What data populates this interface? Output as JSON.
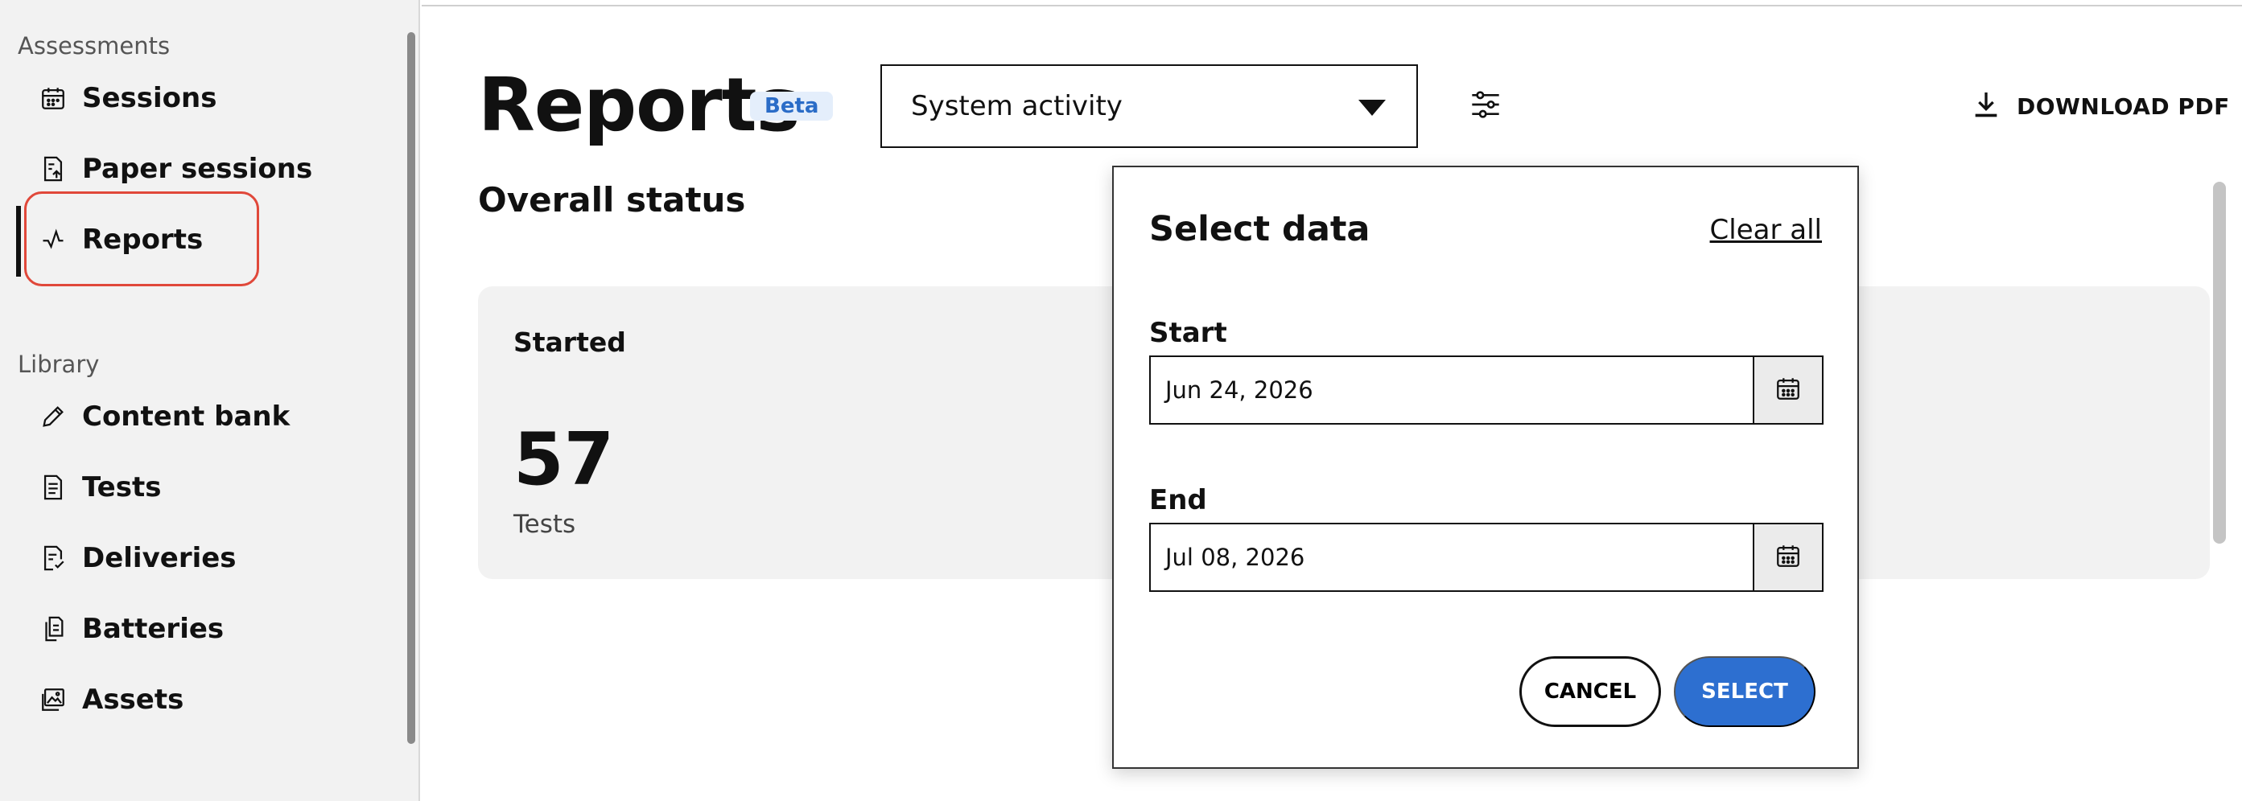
{
  "sidebar": {
    "sections": [
      {
        "label": "Assessments",
        "items": [
          {
            "label": "Sessions",
            "icon": "calendar-icon"
          },
          {
            "label": "Paper sessions",
            "icon": "paper-upload-icon"
          },
          {
            "label": "Reports",
            "icon": "activity-icon",
            "active": true
          }
        ]
      },
      {
        "label": "Library",
        "items": [
          {
            "label": "Content bank",
            "icon": "pencil-icon"
          },
          {
            "label": "Tests",
            "icon": "document-icon"
          },
          {
            "label": "Deliveries",
            "icon": "document-check-icon"
          },
          {
            "label": "Batteries",
            "icon": "documents-icon"
          },
          {
            "label": "Assets",
            "icon": "image-icon"
          }
        ]
      }
    ]
  },
  "header": {
    "title": "Reports",
    "badge": "Beta",
    "report_select": {
      "selected": "System activity"
    },
    "download_label": "DOWNLOAD PDF"
  },
  "main": {
    "section_title": "Overall status",
    "card": {
      "title": "Started",
      "value": "57",
      "unit": "Tests"
    }
  },
  "popover": {
    "title": "Select data",
    "clear_all": "Clear all",
    "start": {
      "label": "Start",
      "value": "Jun 24, 2026"
    },
    "end": {
      "label": "End",
      "value": "Jul 08, 2026"
    },
    "cancel_label": "CANCEL",
    "select_label": "SELECT"
  },
  "colors": {
    "accent": "#2d6fd0",
    "highlight": "#e0483a",
    "badge_bg": "#e4eefb",
    "badge_text": "#2a6cc7"
  }
}
